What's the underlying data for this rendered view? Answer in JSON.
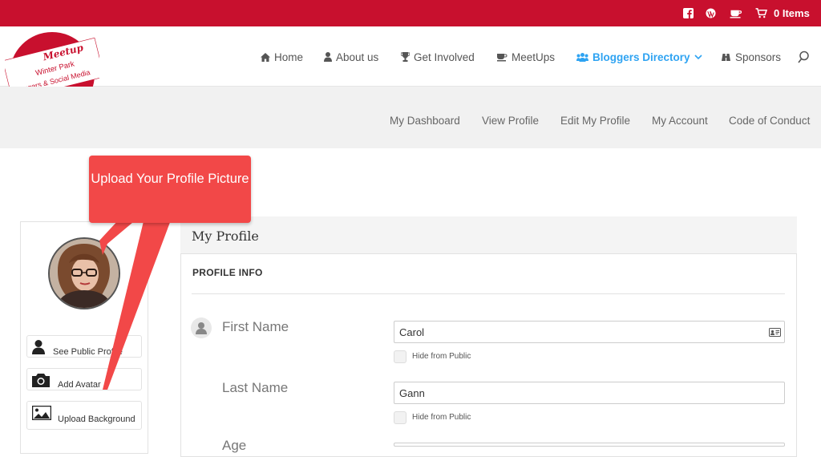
{
  "topbar": {
    "icons": [
      "facebook-icon",
      "wordpress-icon",
      "coffee-cup-icon",
      "cart-icon"
    ],
    "cart_label": "0 Items"
  },
  "logo": {
    "line1": "Meetup",
    "line2": "Winter Park",
    "line3": "Bloggers & Social Media"
  },
  "nav": {
    "items": [
      {
        "label": "Home",
        "icon": "home-icon"
      },
      {
        "label": "About us",
        "icon": "user-icon"
      },
      {
        "label": "Get Involved",
        "icon": "trophy-icon"
      },
      {
        "label": "MeetUps",
        "icon": "coffee-icon"
      },
      {
        "label": "Bloggers Directory",
        "icon": "users-icon",
        "active": true
      },
      {
        "label": "Sponsors",
        "icon": "binoculars-icon"
      }
    ],
    "search_icon": "search-icon"
  },
  "subnav": {
    "items": [
      "My Dashboard",
      "View Profile",
      "Edit My Profile",
      "My Account",
      "Code of Conduct"
    ]
  },
  "sidebar": {
    "buttons": [
      {
        "label": "See Public Profile",
        "icon": "person-icon"
      },
      {
        "label": "Add Avatar",
        "icon": "camera-icon"
      },
      {
        "label": "Upload Background",
        "icon": "image-icon"
      }
    ]
  },
  "callout": {
    "text": "Upload Your Profile Picture"
  },
  "profile": {
    "title": "My Profile",
    "section": "PROFILE INFO",
    "fields": [
      {
        "label": "First Name",
        "value": "Carol",
        "hide_label": "Hide from Public"
      },
      {
        "label": "Last Name",
        "value": "Gann",
        "hide_label": "Hide from Public"
      },
      {
        "label": "Age",
        "value": ""
      }
    ]
  },
  "colors": {
    "brand_red": "#c8102e",
    "accent_blue": "#2ea3f2",
    "callout_red": "#f24848"
  }
}
